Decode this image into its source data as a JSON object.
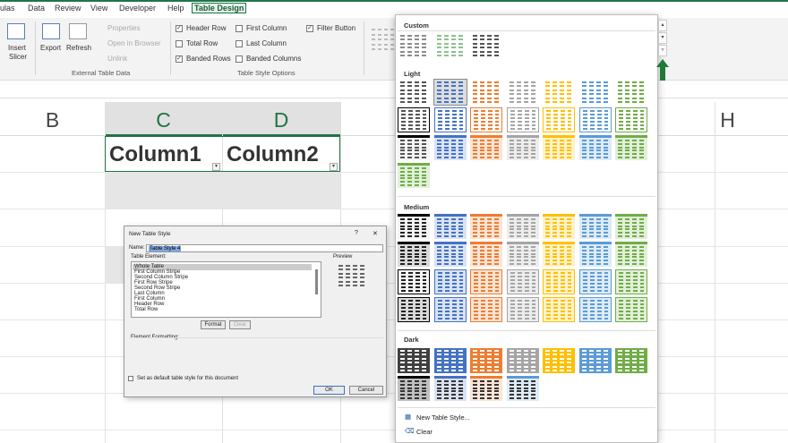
{
  "menu": {
    "items": [
      "ulas",
      "Data",
      "Review",
      "View",
      "Developer",
      "Help"
    ],
    "active": "Table Design"
  },
  "ribbon": {
    "insert_slicer": "Insert\nSlicer",
    "insert_label": "Insert",
    "slicer_label": "Slicer",
    "export": "Export",
    "refresh": "Refresh",
    "properties": "Properties",
    "open_browser": "Open in Browser",
    "unlink": "Unlink",
    "external_group": "External Table Data",
    "header_row": "Header Row",
    "total_row": "Total Row",
    "banded_rows": "Banded Rows",
    "first_column": "First Column",
    "last_column": "Last Column",
    "banded_columns": "Banded Columns",
    "filter_button": "Filter Button",
    "options_group": "Table Style Options"
  },
  "sheet": {
    "col_b": "B",
    "col_c": "C",
    "col_d": "D",
    "col_h": "H",
    "header1": "Column1",
    "header2": "Column2"
  },
  "dialog": {
    "title": "New Table Style",
    "help": "?",
    "close": "✕",
    "name_label": "Name:",
    "name_value": "Table Style 4",
    "element_label": "Table Element:",
    "preview_label": "Preview",
    "elements": [
      "Whole Table",
      "First Column Stripe",
      "Second Column Stripe",
      "First Row Stripe",
      "Second Row Stripe",
      "Last Column",
      "First Column",
      "Header Row",
      "Total Row"
    ],
    "format": "Format",
    "clear": "Clear",
    "element_formatting": "Element Formatting:",
    "default_check": "Set as default table style for this document",
    "ok": "OK",
    "cancel": "Cancel"
  },
  "gallery": {
    "custom": "Custom",
    "light": "Light",
    "medium": "Medium",
    "dark": "Dark",
    "new_style": "New Table Style...",
    "clear": "Clear",
    "colors": [
      "#000000",
      "#4472c4",
      "#ed7d31",
      "#a5a5a5",
      "#ffc000",
      "#5b9bd5",
      "#70ad47"
    ]
  }
}
